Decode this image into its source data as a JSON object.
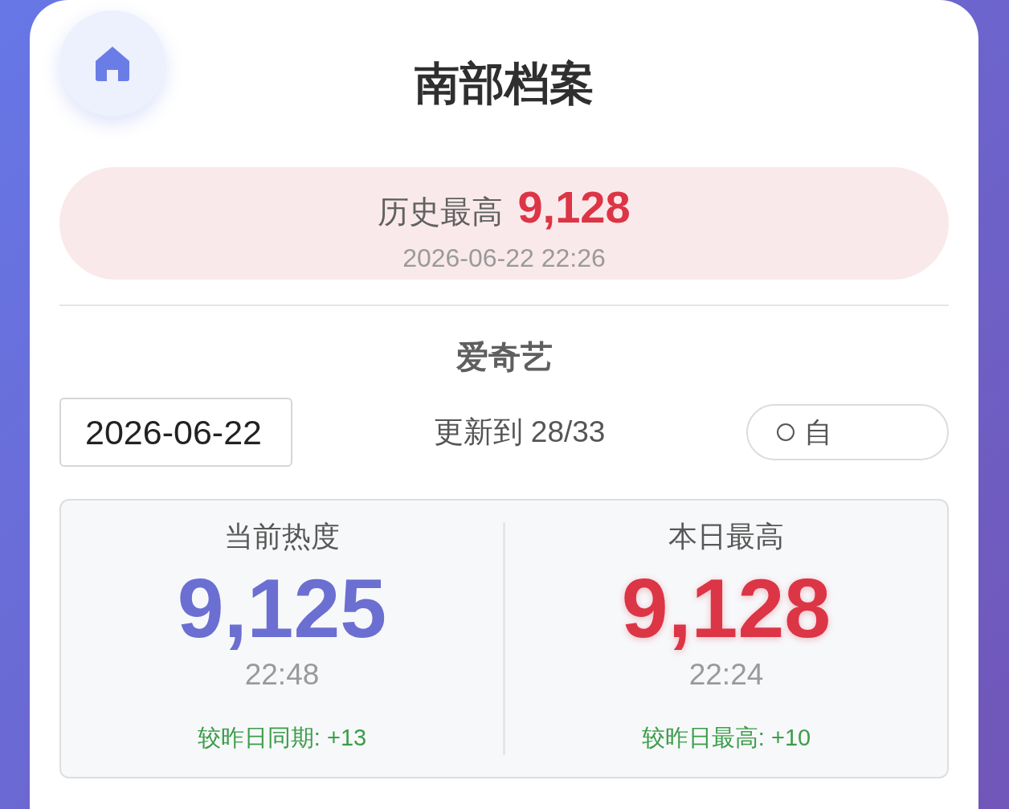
{
  "title": "南部档案",
  "record": {
    "label": "历史最高",
    "value": "9,128",
    "time": "2026-06-22 22:26"
  },
  "platform": "爱奇艺",
  "controls": {
    "date": "2026-06-22",
    "progress": "更新到 28/33",
    "toggle": {
      "label": "自",
      "on": false
    }
  },
  "stats": [
    {
      "kind": "current",
      "label": "当前热度",
      "value": "9,125",
      "time": "22:48",
      "change": "较昨日同期: +13",
      "color": "#6b6fd1"
    },
    {
      "kind": "peak",
      "label": "本日最高",
      "value": "9,128",
      "time": "22:24",
      "change": "较昨日最高: +10",
      "color": "#dc3545"
    }
  ]
}
